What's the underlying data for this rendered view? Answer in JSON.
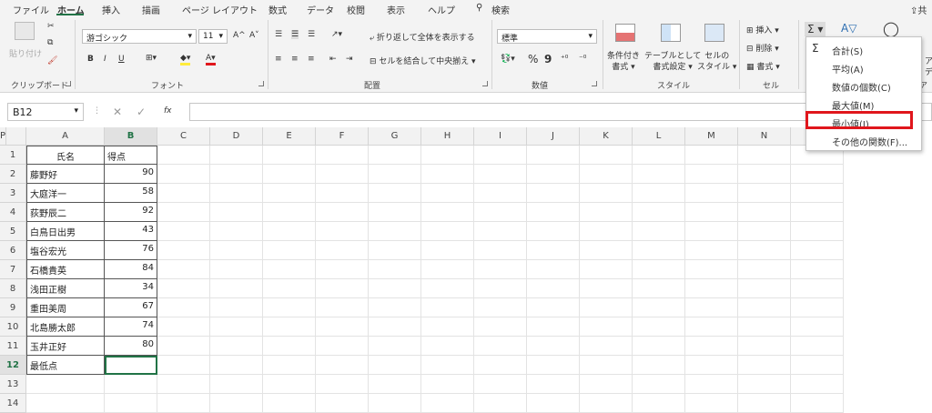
{
  "ribbon_tabs": [
    "ファイル",
    "ホーム",
    "挿入",
    "描画",
    "ページ レイアウト",
    "数式",
    "データ",
    "校閲",
    "表示",
    "ヘルプ"
  ],
  "search_label": "検索",
  "share_label": "共",
  "clipboard": {
    "paste": "貼り付け",
    "group": "クリップボード"
  },
  "font": {
    "name": "游ゴシック",
    "size": "11",
    "grow": "A^",
    "shrink": "A˅",
    "bold": "B",
    "italic": "I",
    "underline": "U",
    "group": "フォント"
  },
  "alignment": {
    "wrap": "折り返して全体を表示する",
    "merge": "セルを結合して中央揃え",
    "group": "配置"
  },
  "number": {
    "format": "標準",
    "percent": "%",
    "comma": "9",
    "group": "数値"
  },
  "styles": {
    "conditional": [
      "条件付き",
      "書式"
    ],
    "table": [
      "テーブルとして",
      "書式設定"
    ],
    "cell": [
      "セルの",
      "スタイル"
    ],
    "group": "スタイル"
  },
  "cells": {
    "insert": "挿入",
    "delete": "削除",
    "format": "書式",
    "group": "セル"
  },
  "editing": {
    "sigma": "Σ",
    "a_label": "ア",
    "a_sub": "デ",
    "group": "アイ"
  },
  "namebox": "B12",
  "fx": "fx",
  "columns": [
    "A",
    "B",
    "C",
    "D",
    "E",
    "F",
    "G",
    "H",
    "I",
    "J",
    "K",
    "L",
    "M",
    "N",
    "O",
    "P"
  ],
  "rows": [
    "1",
    "2",
    "3",
    "4",
    "5",
    "6",
    "7",
    "8",
    "9",
    "10",
    "11",
    "12",
    "13",
    "14"
  ],
  "headers": {
    "name": "氏名",
    "score": "得点"
  },
  "students": [
    {
      "name": "藤野好",
      "score": "90"
    },
    {
      "name": "大庭洋一",
      "score": "58"
    },
    {
      "name": "荻野辰二",
      "score": "92"
    },
    {
      "name": "白鳥日出男",
      "score": "43"
    },
    {
      "name": "塩谷宏光",
      "score": "76"
    },
    {
      "name": "石橋貴英",
      "score": "84"
    },
    {
      "name": "浅田正樹",
      "score": "34"
    },
    {
      "name": "重田美周",
      "score": "67"
    },
    {
      "name": "北島勝太郎",
      "score": "74"
    },
    {
      "name": "玉井正好",
      "score": "80"
    }
  ],
  "min_label": "最低点",
  "dropdown": {
    "items": [
      "合計(S)",
      "平均(A)",
      "数値の個数(C)",
      "最大値(M)",
      "最小値(I)",
      "その他の関数(F)..."
    ]
  },
  "colors": {
    "accent": "#217346",
    "highlight": "#e0161c"
  }
}
